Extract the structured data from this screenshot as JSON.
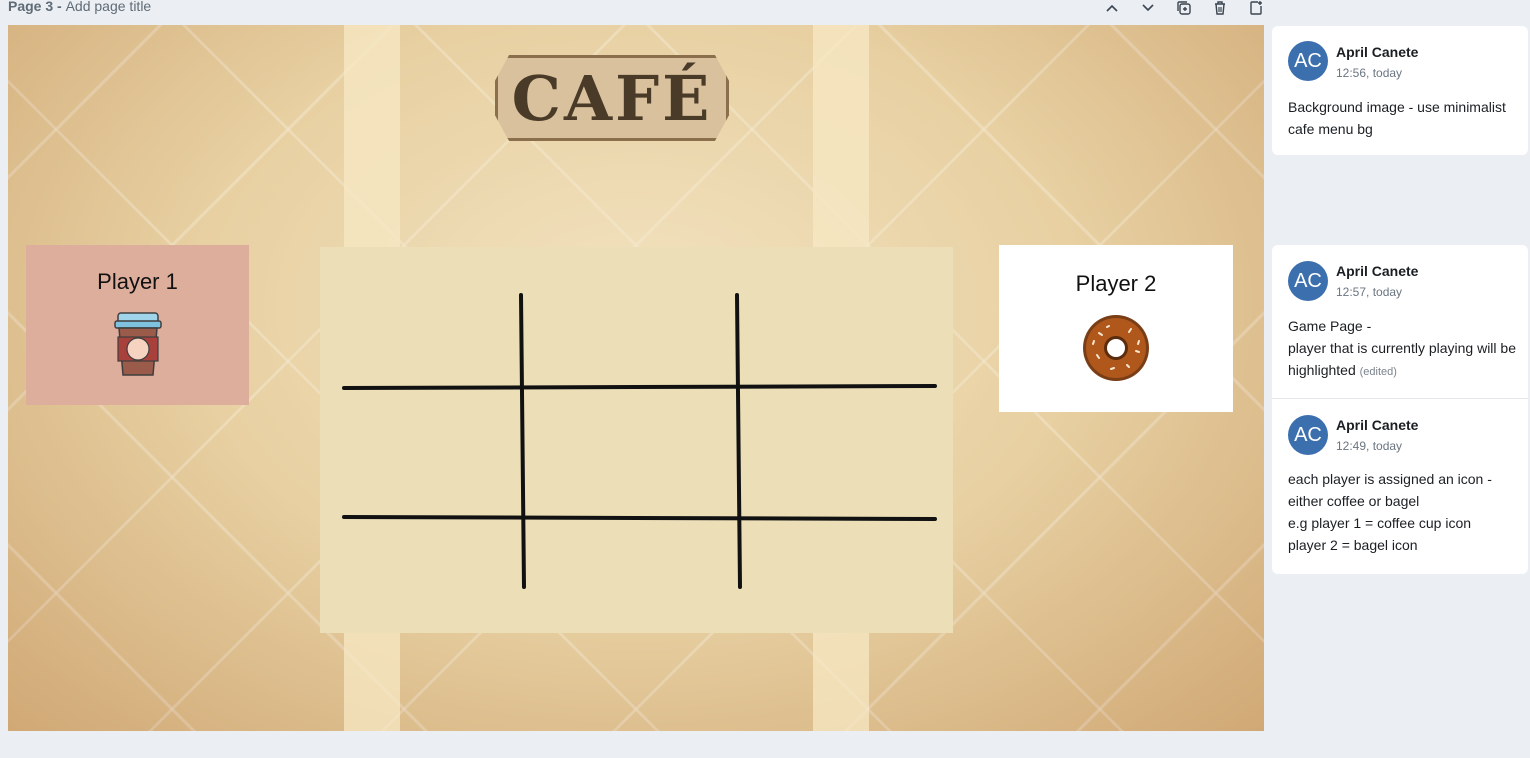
{
  "page": {
    "title": "Page 3",
    "subtitle": "Add page title"
  },
  "toolbar": {
    "icons": [
      "chevron-up-icon",
      "chevron-down-icon",
      "duplicate-page-icon",
      "trash-icon",
      "add-page-icon"
    ]
  },
  "canvas": {
    "sign_text": "CAFÉ",
    "player1": {
      "label": "Player 1",
      "icon": "coffee-cup-icon"
    },
    "player2": {
      "label": "Player 2",
      "icon": "donut-icon"
    },
    "board": {
      "type": "tic-tac-toe grid"
    }
  },
  "comments": [
    {
      "avatar": "AC",
      "author": "April Canete",
      "time": "12:56, today",
      "lines": [
        "Background image - use minimalist cafe menu bg"
      ]
    },
    {
      "avatar": "AC",
      "author": "April Canete",
      "time": "12:57, today",
      "lines": [
        "Game Page -",
        "player that is currently playing will be highlighted"
      ],
      "edited": "(edited)"
    },
    {
      "avatar": "AC",
      "author": "April Canete",
      "time": "12:49, today",
      "lines": [
        "each player is assigned an icon - either coffee or bagel",
        "e.g player 1 = coffee cup icon",
        "player 2 = bagel icon"
      ]
    }
  ],
  "colors": {
    "player1_highlight": "#deae9d",
    "player2_bg": "#ffffff",
    "board_bg": "#ecdfb7",
    "avatar_bg": "#3b6fae"
  }
}
